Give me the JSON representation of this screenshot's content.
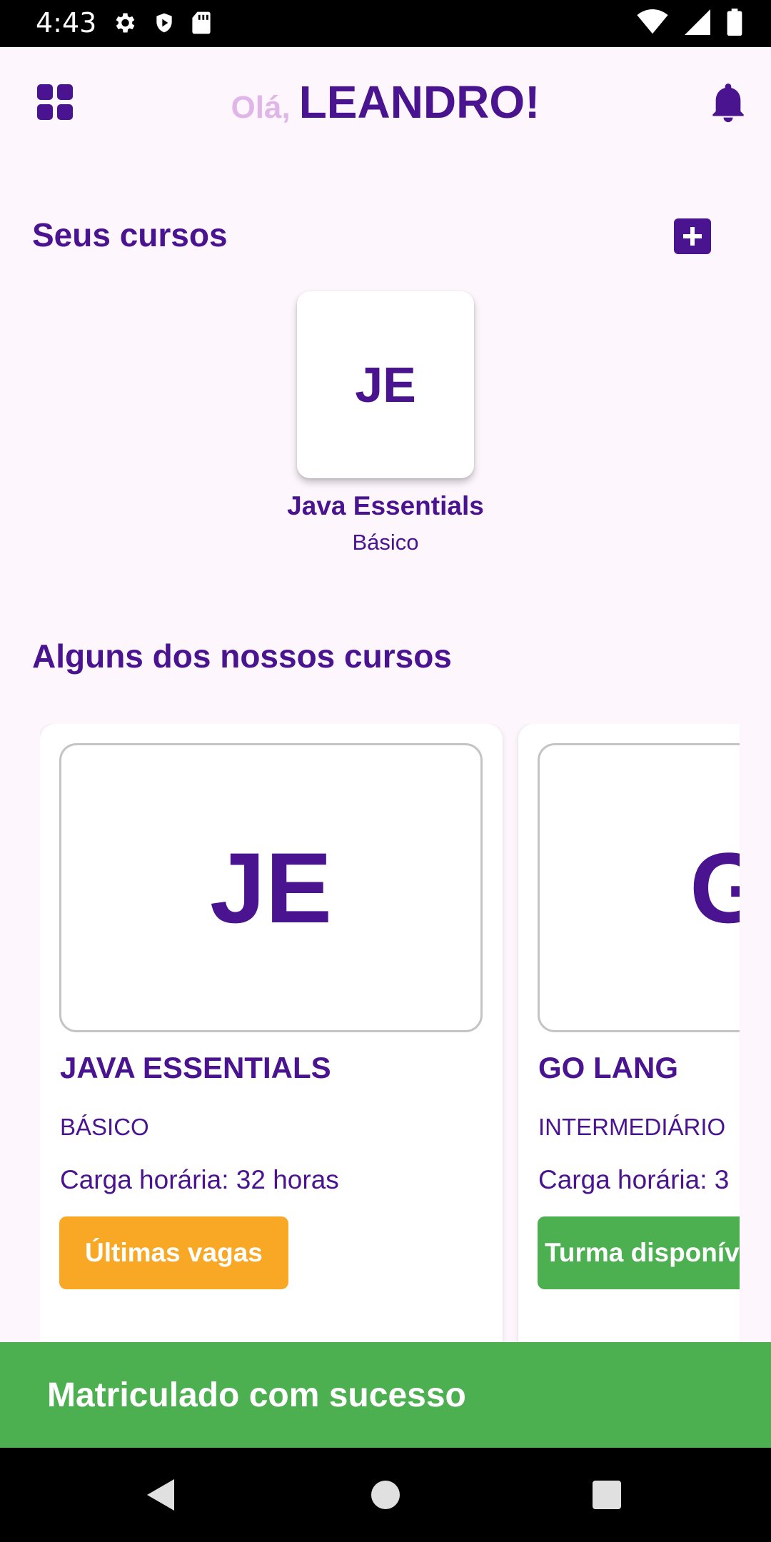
{
  "status_bar": {
    "time": "4:43"
  },
  "header": {
    "greeting_prefix": "Olá,",
    "user_name": "LEANDRO!"
  },
  "my_courses": {
    "title": "Seus cursos",
    "items": [
      {
        "initials": "JE",
        "name": "Java Essentials",
        "level": "Básico"
      }
    ]
  },
  "catalog": {
    "title": "Alguns dos nossos cursos",
    "items": [
      {
        "initials": "JE",
        "name": "JAVA ESSENTIALS",
        "level": "BÁSICO",
        "hours": "Carga horária: 32 horas",
        "status": "Últimas vagas",
        "status_color": "#f9a825"
      },
      {
        "initials": "GO",
        "name": "GO LANG",
        "level": "INTERMEDIÁRIO",
        "hours": "Carga horária: 3",
        "status": "Turma disponív",
        "status_color": "#4caf50"
      }
    ]
  },
  "snackbar": {
    "message": "Matriculado com sucesso",
    "color": "#4caf50"
  },
  "colors": {
    "primary": "#4a138f",
    "greeting_light": "#e0b6e9",
    "background": "#fdf7fd"
  },
  "icons": {
    "grid": "dashboard-grid-icon",
    "bell": "notification-bell-icon",
    "add": "add-box-icon",
    "nav_back": "back-triangle-icon",
    "nav_home": "home-circle-icon",
    "nav_recents": "recents-square-icon"
  }
}
